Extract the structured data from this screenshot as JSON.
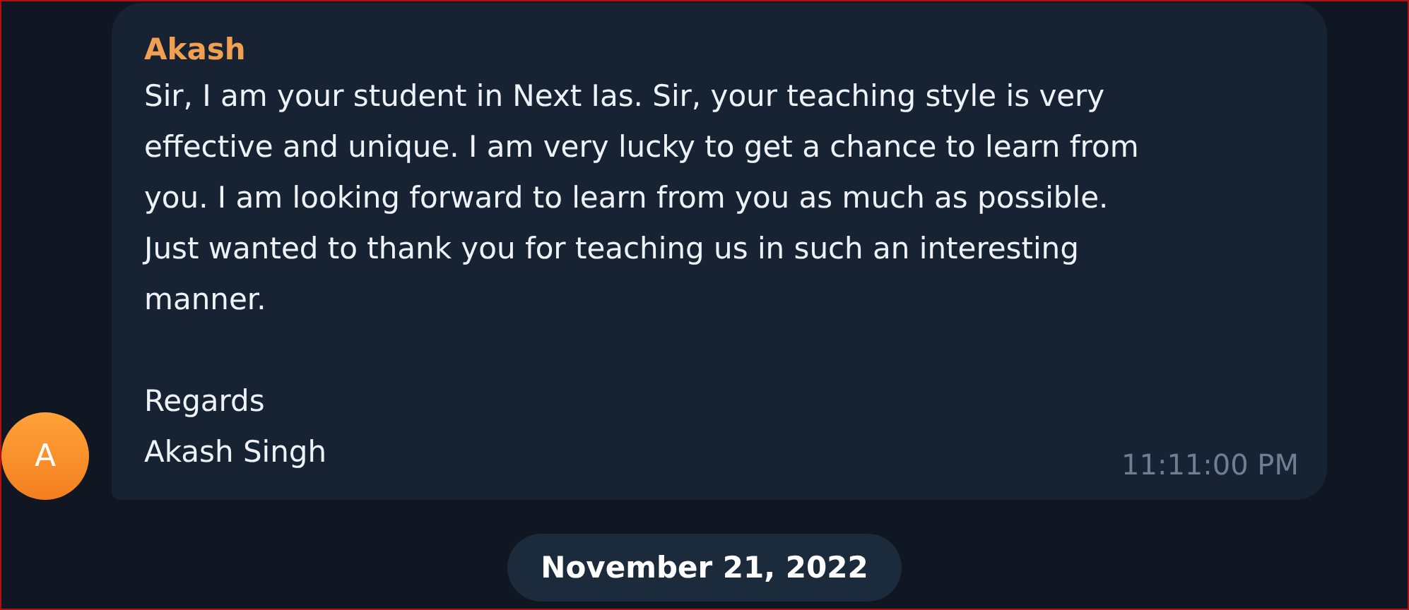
{
  "messages": [
    {
      "sender": "Akash",
      "avatar_letter": "A",
      "paragraphs": [
        "Sir, I am your student in Next Ias. Sir, your teaching style is very\neffective and unique. I am very lucky to get a chance to learn from\nyou. I am looking forward to learn from you as much as possible.\nJust wanted to thank you for teaching us in such an interesting\nmanner.",
        "Regards\nAkash Singh"
      ],
      "time": "11:11:00 PM"
    }
  ],
  "date_separator": "November 21, 2022"
}
